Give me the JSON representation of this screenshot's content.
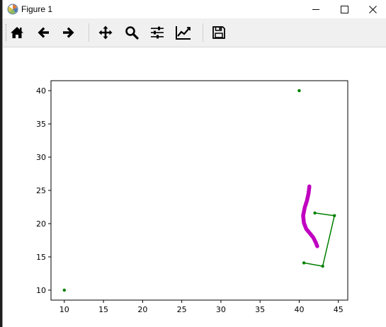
{
  "window": {
    "title": "Figure 1",
    "controls": {
      "minimize": "—",
      "maximize": "☐",
      "close": "✕"
    }
  },
  "toolbar": {
    "items": [
      {
        "name": "home-button",
        "icon": "home-icon"
      },
      {
        "name": "back-button",
        "icon": "arrow-left-icon"
      },
      {
        "name": "forward-button",
        "icon": "arrow-right-icon"
      },
      {
        "name": "pan-button",
        "icon": "move-icon"
      },
      {
        "name": "zoom-button",
        "icon": "magnifier-icon"
      },
      {
        "name": "configure-subplots-button",
        "icon": "sliders-icon"
      },
      {
        "name": "edit-axis-button",
        "icon": "line-chart-icon"
      },
      {
        "name": "save-button",
        "icon": "floppy-disk-icon"
      }
    ]
  },
  "chart_data": {
    "type": "scatter",
    "xlim": [
      8.3,
      46.2
    ],
    "ylim": [
      8.5,
      41.5
    ],
    "xticks": [
      10,
      15,
      20,
      25,
      30,
      35,
      40,
      45
    ],
    "yticks": [
      10,
      15,
      20,
      25,
      30,
      35,
      40
    ],
    "series": [
      {
        "kind": "points",
        "color": "#008000",
        "x": [
          10,
          40
        ],
        "y": [
          10,
          40
        ]
      },
      {
        "kind": "polyline-markers",
        "color": "#008000",
        "x": [
          42.0,
          44.5,
          43.0,
          40.6
        ],
        "y": [
          21.6,
          21.2,
          13.6,
          14.1
        ]
      },
      {
        "kind": "thick-curve",
        "color": "#c000c0",
        "x": [
          41.3,
          41.2,
          41.0,
          40.7,
          40.5,
          40.6,
          40.9,
          41.4,
          41.8,
          42.1,
          42.3
        ],
        "y": [
          25.6,
          24.6,
          23.5,
          22.4,
          21.2,
          20.1,
          19.2,
          18.5,
          17.9,
          17.2,
          16.6
        ]
      }
    ]
  }
}
